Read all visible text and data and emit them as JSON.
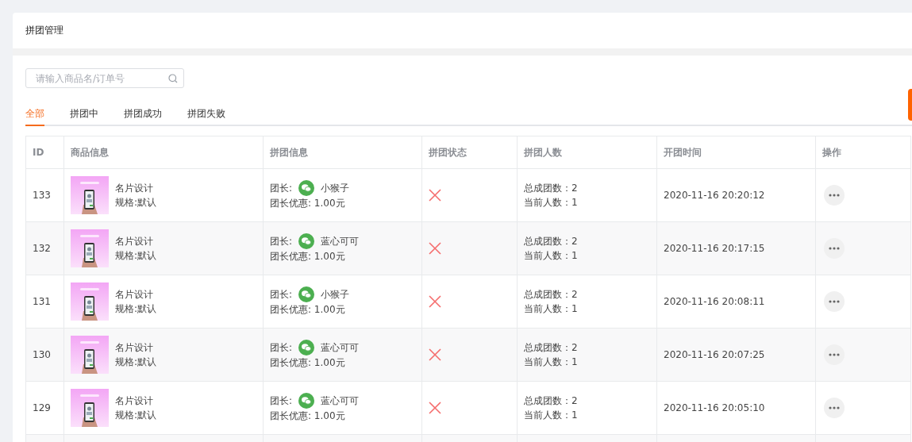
{
  "header": {
    "title": "拼团管理"
  },
  "search": {
    "placeholder": "请输入商品名/订单号"
  },
  "tabs": [
    {
      "label": "全部",
      "selected": true
    },
    {
      "label": "拼团中",
      "selected": false
    },
    {
      "label": "拼团成功",
      "selected": false
    },
    {
      "label": "拼团失败",
      "selected": false
    }
  ],
  "table": {
    "columns": [
      "ID",
      "商品信息",
      "拼团信息",
      "拼团状态",
      "拼团人数",
      "开团时间",
      "操作"
    ],
    "rows": [
      {
        "id": "133",
        "product": {
          "name": "名片设计",
          "spec": "规格:默认"
        },
        "leader_label": "团长:",
        "leader": "小猴子",
        "discount": "团长优惠: 1.00元",
        "failed": true,
        "total": "总成团数：2",
        "current": "当前人数：1",
        "time": "2020-11-16 20:20:12"
      },
      {
        "id": "132",
        "product": {
          "name": "名片设计",
          "spec": "规格:默认"
        },
        "leader_label": "团长:",
        "leader": "蓝心可可",
        "discount": "团长优惠: 1.00元",
        "failed": true,
        "total": "总成团数：2",
        "current": "当前人数：1",
        "time": "2020-11-16 20:17:15"
      },
      {
        "id": "131",
        "product": {
          "name": "名片设计",
          "spec": "规格:默认"
        },
        "leader_label": "团长:",
        "leader": "小猴子",
        "discount": "团长优惠: 1.00元",
        "failed": true,
        "total": "总成团数：2",
        "current": "当前人数：1",
        "time": "2020-11-16 20:08:11"
      },
      {
        "id": "130",
        "product": {
          "name": "名片设计",
          "spec": "规格:默认"
        },
        "leader_label": "团长:",
        "leader": "蓝心可可",
        "discount": "团长优惠: 1.00元",
        "failed": true,
        "total": "总成团数：2",
        "current": "当前人数：1",
        "time": "2020-11-16 20:07:25"
      },
      {
        "id": "129",
        "product": {
          "name": "名片设计",
          "spec": "规格:默认"
        },
        "leader_label": "团长:",
        "leader": "蓝心可可",
        "discount": "团长优惠: 1.00元",
        "failed": true,
        "total": "总成团数：2",
        "current": "当前人数：1",
        "time": "2020-11-16 20:05:10"
      }
    ]
  }
}
